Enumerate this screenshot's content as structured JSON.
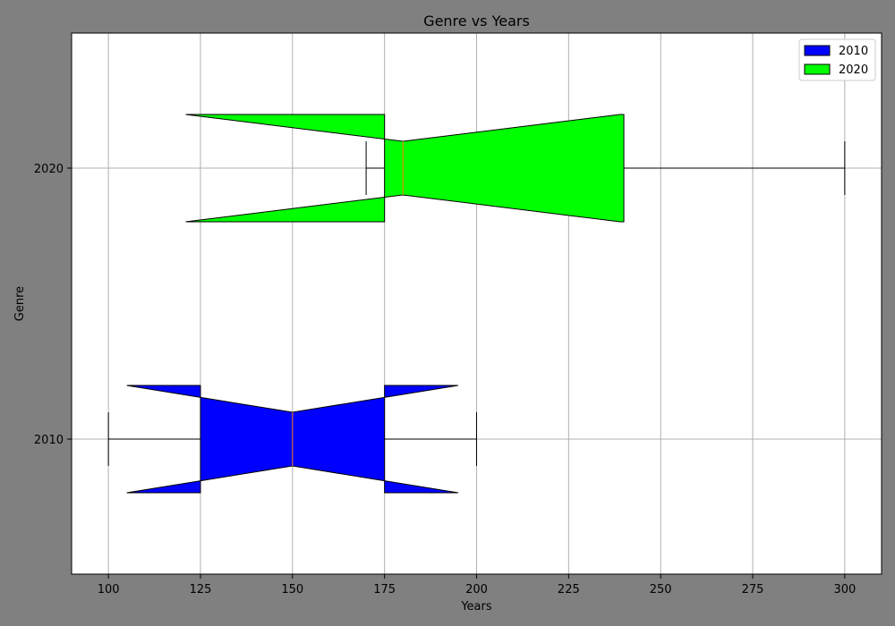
{
  "chart_data": {
    "type": "boxplot",
    "orientation": "horizontal",
    "notched": true,
    "title": "Genre vs Years",
    "xlabel": "Years",
    "ylabel": "Genre",
    "xlim": [
      90,
      310
    ],
    "x_ticks": [
      100,
      125,
      150,
      175,
      200,
      225,
      250,
      275,
      300
    ],
    "y_categories": [
      "2010",
      "2020"
    ],
    "grid": true,
    "legend_position": "top-right",
    "colors": {
      "background": "#808080",
      "plot_bg": "#ffffff",
      "median": "#ff7f0e"
    },
    "series": [
      {
        "name": "2010",
        "color": "#0000ff",
        "whisker_low": 100,
        "q1": 125,
        "median": 150,
        "q3": 175,
        "whisker_high": 200,
        "notch_low": 105,
        "notch_high": 195
      },
      {
        "name": "2020",
        "color": "#00ff00",
        "whisker_low": 170,
        "q1": 175,
        "median": 180,
        "q3": 240,
        "whisker_high": 300,
        "notch_low": 121,
        "notch_high": 239
      }
    ]
  }
}
